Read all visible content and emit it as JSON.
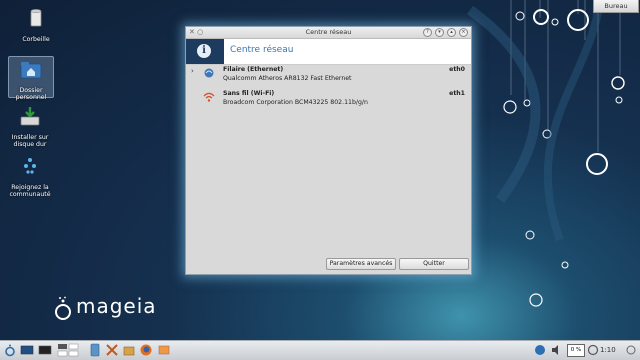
{
  "desktop": {
    "icons": [
      {
        "label": "Corbeille",
        "icon": "trash-icon"
      },
      {
        "label": "Dossier personnel",
        "icon": "home-folder-icon"
      },
      {
        "label": "Installer sur disque dur",
        "icon": "install-icon"
      },
      {
        "label": "Rejoignez la communauté",
        "icon": "community-icon"
      }
    ],
    "bureau_button": "Bureau",
    "logo_text": "mageia"
  },
  "window": {
    "title": "Centre réseau",
    "header_title": "Centre réseau",
    "connections": [
      {
        "name": "Filaire (Ethernet)",
        "description": "Qualcomm Atheros AR8132 Fast Ethernet",
        "interface": "eth0",
        "icon": "ethernet-icon",
        "expanded": false
      },
      {
        "name": "Sans fil (Wi-Fi)",
        "description": "Broadcom Corporation BCM43225 802.11b/g/n",
        "interface": "eth1",
        "icon": "wifi-icon",
        "expanded": false
      }
    ],
    "advanced_button": "Paramètres avancés",
    "quit_button": "Quitter"
  },
  "taskbar": {
    "battery_percent": "0 %",
    "clock": "1:10"
  },
  "colors": {
    "header_tab": "#1d3a5f",
    "header_title": "#3a76b0",
    "window_glow": "#78bee6"
  }
}
